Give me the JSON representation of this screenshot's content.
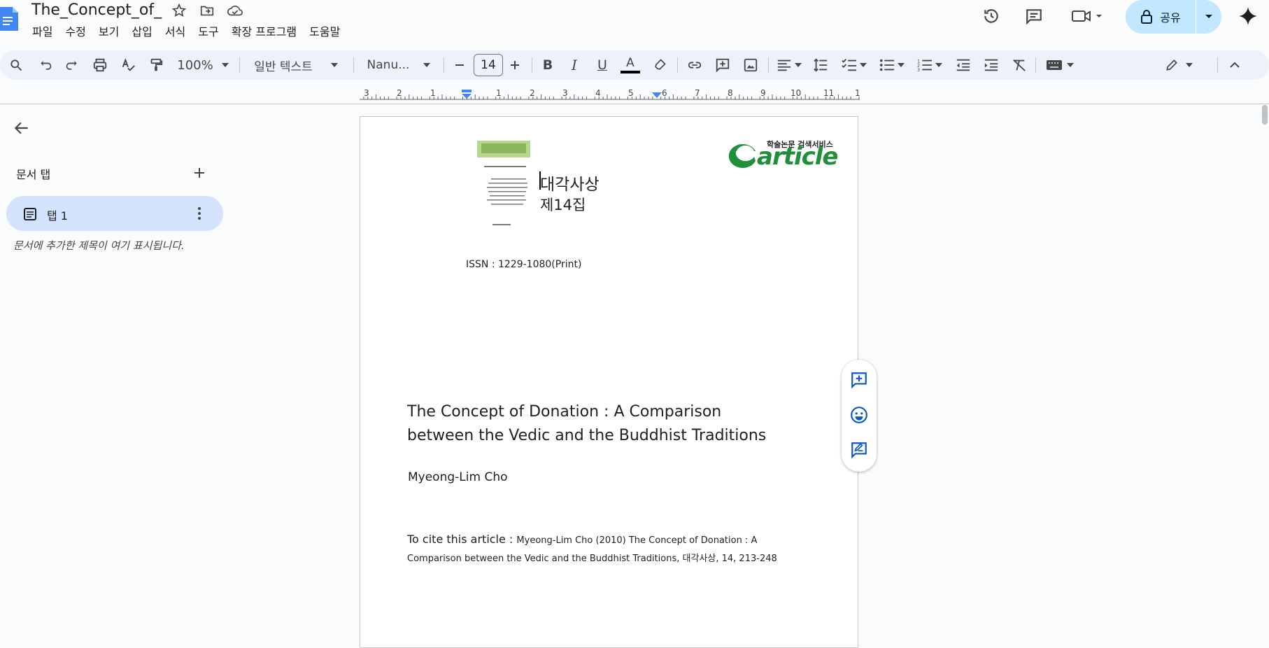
{
  "header": {
    "title": "The_Concept_of_",
    "menu": [
      "파일",
      "수정",
      "보기",
      "삽입",
      "서식",
      "도구",
      "확장 프로그램",
      "도움말"
    ],
    "share_label": "공유"
  },
  "toolbar": {
    "zoom": "100%",
    "style": "일반 텍스트",
    "font": "Nanu...",
    "font_size": "14"
  },
  "ruler": {
    "left_numbers": [
      "3",
      "2",
      "1"
    ],
    "right_numbers": [
      "1",
      "2",
      "3",
      "4",
      "5",
      "6",
      "7",
      "8",
      "9",
      "10",
      "11",
      "1"
    ]
  },
  "sidebar": {
    "heading": "문서 탭",
    "tab_label": "탭 1",
    "note": "문서에 추가한 제목이 여기 표시됩니다."
  },
  "document": {
    "logo_text": "학술논문 검색서비스",
    "logo_word": "article",
    "journal_name": "대각사상",
    "journal_issue": "제14집",
    "issn": "ISSN : 1229-1080(Print)",
    "title_line1": "The Concept of Donation : A Comparison",
    "title_line2": "between the Vedic and the Buddhist Traditions",
    "author": "Myeong-Lim Cho",
    "cite_lead": "To cite this article : ",
    "cite_text": "Myeong-Lim Cho (2010) The Concept of Donation : A",
    "cite_text2": "Comparison between the Vedic and the Buddhist Traditions, 대각사상, 14, 213-248"
  },
  "colors": {
    "accent": "#0b57d0",
    "share_bg": "#c2e7ff",
    "toolbar_bg": "#edf2fa",
    "logo_green": "#1f8f3a"
  }
}
